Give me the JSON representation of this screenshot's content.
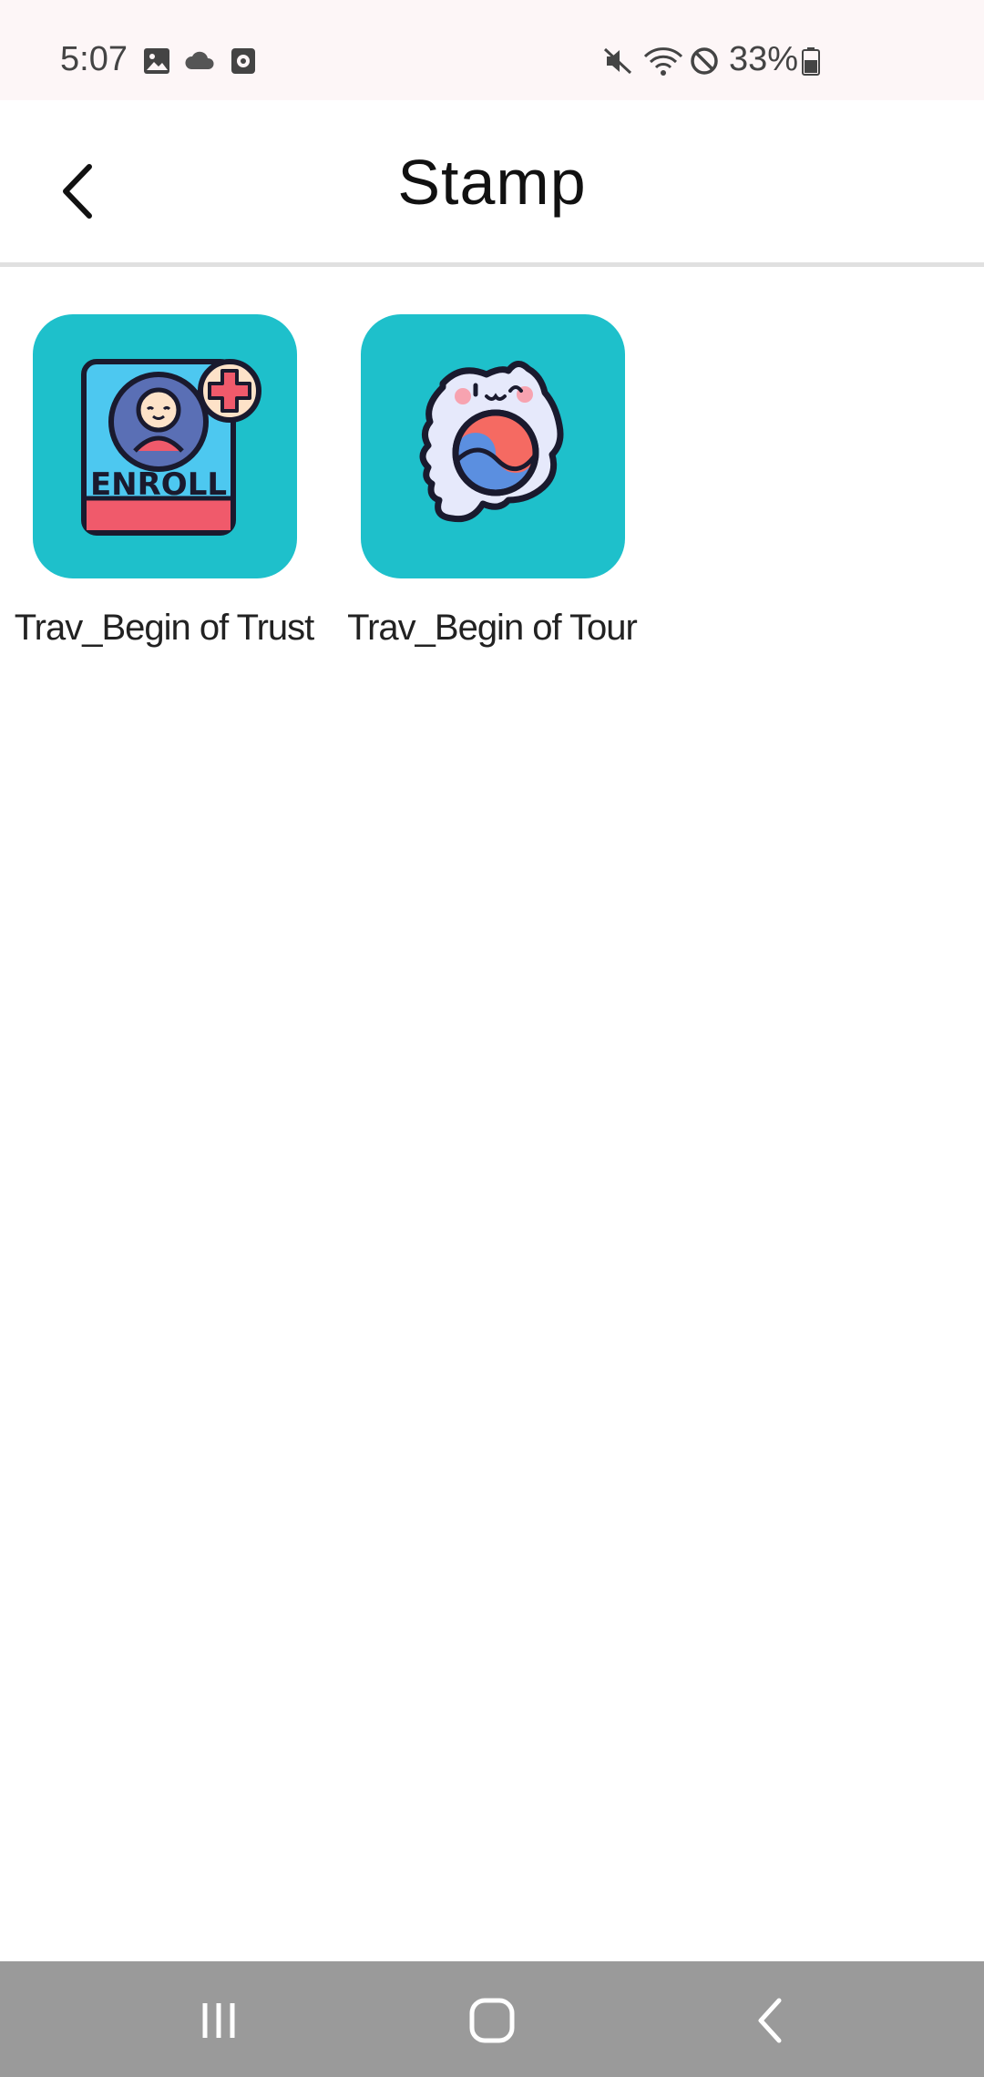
{
  "status_bar": {
    "time": "5:07",
    "battery": "33%",
    "icons": [
      "image-icon",
      "cloud-icon",
      "record-icon",
      "mute-icon",
      "wifi-icon",
      "do-not-disturb-icon",
      "battery-icon"
    ]
  },
  "header": {
    "title": "Stamp",
    "back_icon": "chevron-left-icon"
  },
  "stamps": [
    {
      "label": "Trav_Begin of Trust",
      "icon": "enroll-badge-icon",
      "tile_color": "#1ec0cb",
      "badge_text": "ENROLL"
    },
    {
      "label": "Trav_Begin of Tour",
      "icon": "korea-map-icon",
      "tile_color": "#1ec0cb"
    }
  ],
  "nav_bar": {
    "buttons": [
      "recent-apps-icon",
      "home-icon",
      "back-icon"
    ]
  }
}
